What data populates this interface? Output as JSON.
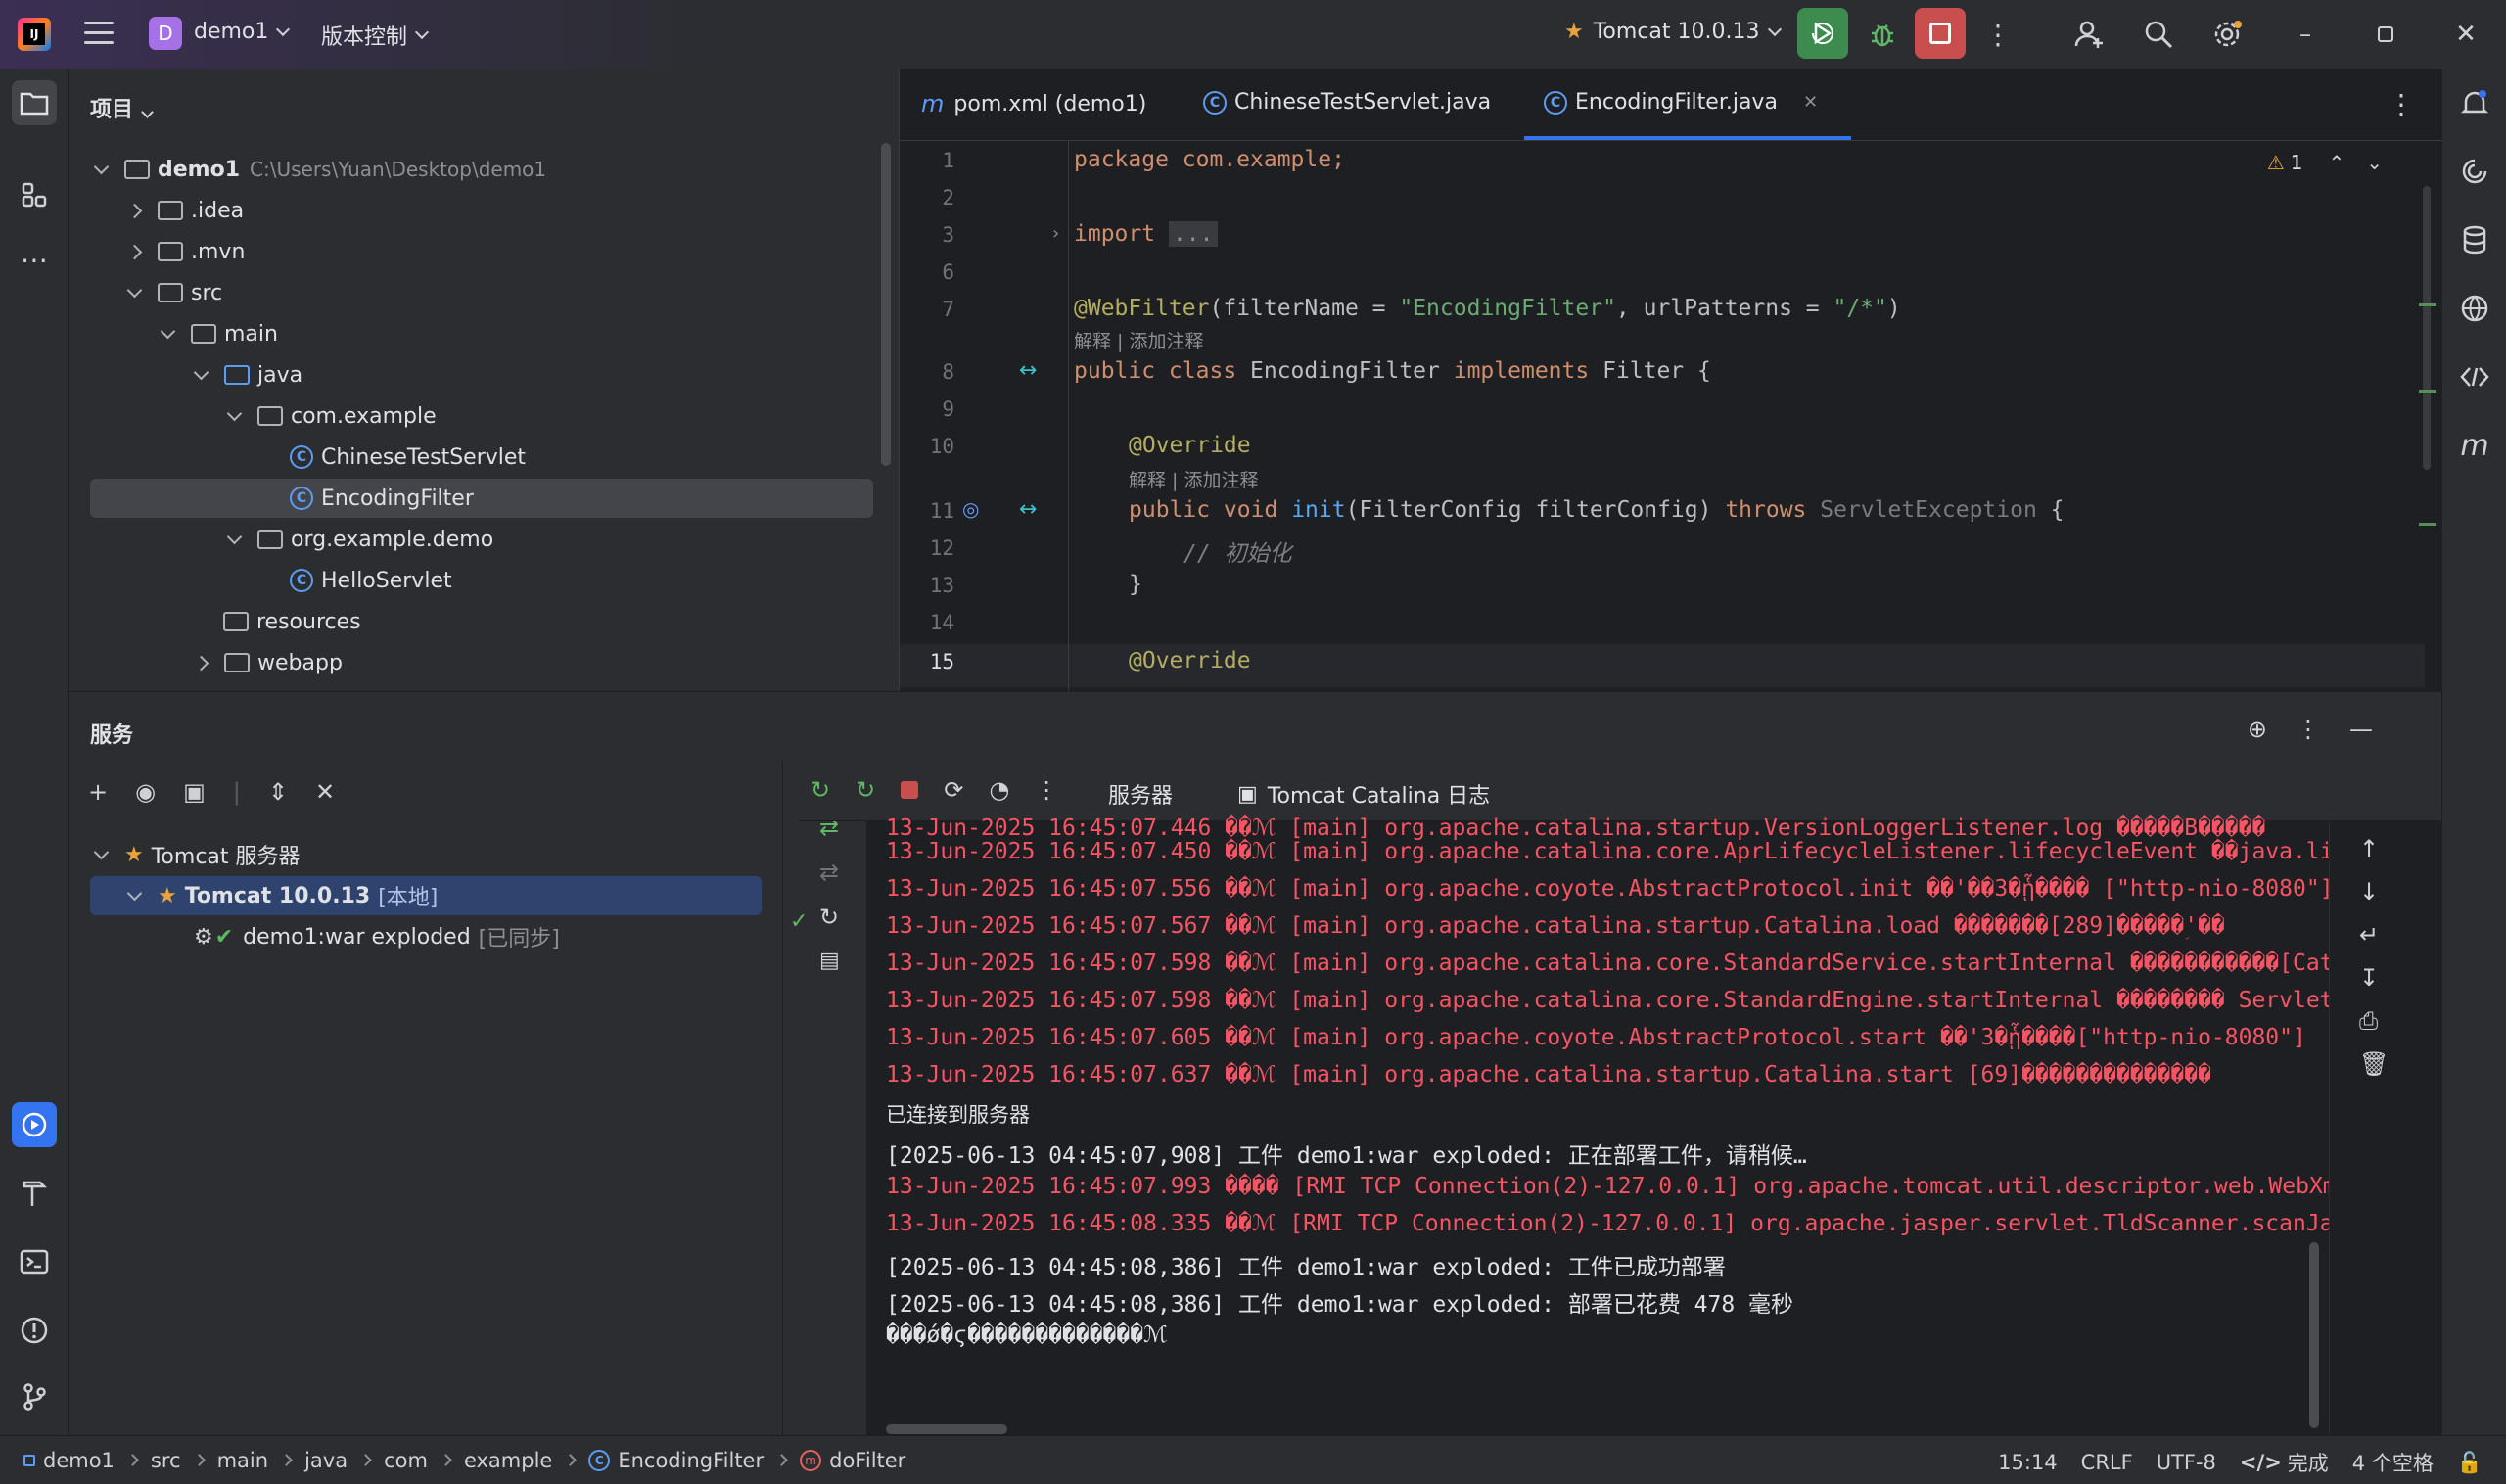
{
  "titlebar": {
    "project_badge": "D",
    "project_name": "demo1",
    "vcs_label": "版本控制",
    "run_config": "Tomcat 10.0.13"
  },
  "project_panel": {
    "title": "项目",
    "tree": [
      {
        "label": "demo1",
        "extra": "C:\\Users\\Yuan\\Desktop\\demo1"
      },
      {
        "label": ".idea"
      },
      {
        "label": ".mvn"
      },
      {
        "label": "src"
      },
      {
        "label": "main"
      },
      {
        "label": "java"
      },
      {
        "label": "com.example"
      },
      {
        "label": "ChineseTestServlet"
      },
      {
        "label": "EncodingFilter"
      },
      {
        "label": "org.example.demo"
      },
      {
        "label": "HelloServlet"
      },
      {
        "label": "resources"
      },
      {
        "label": "webapp"
      }
    ]
  },
  "editor": {
    "tabs": [
      {
        "icon": "m",
        "label": "pom.xml (demo1)"
      },
      {
        "icon": "C",
        "label": "ChineseTestServlet.java"
      },
      {
        "icon": "C",
        "label": "EncodingFilter.java"
      }
    ],
    "warning_count": "1",
    "line_numbers": [
      "1",
      "2",
      "3",
      "6",
      "7",
      "8",
      "9",
      "10",
      "11",
      "12",
      "13",
      "14",
      "15"
    ],
    "code": {
      "l1": "package com.example;",
      "l3_kw": "import",
      "l3_fold": "...",
      "l7_ann": "@WebFilter",
      "l7_a": "(filterName = ",
      "l7_s1": "\"EncodingFilter\"",
      "l7_b": ", urlPatterns = ",
      "l7_s2": "\"/*\"",
      "l7_c": ")",
      "hint": "解释 | 添加注释",
      "l8_kw": "public class",
      "l8_a": " EncodingFilter ",
      "l8_kw2": "implements",
      "l8_b": " Filter {",
      "l10_ann": "@Override",
      "l11_kw": "public void",
      "l11_fn": "init",
      "l11_a": "(FilterConfig filterConfig) ",
      "l11_kw2": "throws",
      "l11_grey": " ServletException",
      "l11_b": " {",
      "l12_cm": "// 初始化",
      "l13": "}",
      "l15_ann": "@Override"
    }
  },
  "services": {
    "title": "服务",
    "tree": [
      {
        "label": "Tomcat 服务器"
      },
      {
        "label": "Tomcat 10.0.13",
        "extra": "[本地]"
      },
      {
        "label": "demo1:war exploded",
        "extra": "[已同步]"
      }
    ],
    "tabs": [
      {
        "label": "服务器"
      },
      {
        "label": "Tomcat Catalina 日志"
      }
    ],
    "log_lines": [
      {
        "text": "13-Jun-2025 16:45:07.446 ��ℳ [main] org.apache.catalina.startup.VersionLoggerListener.log �����B�����     -",
        "red": true
      },
      {
        "text": "13-Jun-2025 16:45:07.450 ��ℳ [main] org.apache.catalina.core.AprLifecycleListener.lifecycleEvent ��java.libra",
        "red": true
      },
      {
        "text": "13-Jun-2025 16:45:07.556 ��ℳ [main] org.apache.coyote.AbstractProtocol.init ��'��3�ᾗ���� [\"http-nio-8080\"]",
        "red": true
      },
      {
        "text": "13-Jun-2025 16:45:07.567 ��ℳ [main] org.apache.catalina.startup.Catalina.load �������[289]�����ؚ'��",
        "red": true
      },
      {
        "text": "13-Jun-2025 16:45:07.598 ��ℳ [main] org.apache.catalina.core.StandardService.startInternal �����������[Catal",
        "red": true
      },
      {
        "text": "13-Jun-2025 16:45:07.598 ��ℳ [main] org.apache.catalina.core.StandardEngine.startInternal �������� Servlet ��",
        "red": true
      },
      {
        "text": "13-Jun-2025 16:45:07.605 ��ℳ [main] org.apache.coyote.AbstractProtocol.start ��'3�ᾗ����[\"http-nio-8080\"]",
        "red": true
      },
      {
        "text": "13-Jun-2025 16:45:07.637 ��ℳ [main] org.apache.catalina.startup.Catalina.start [69]��������������",
        "red": true
      },
      {
        "text": "已连接到服务器",
        "red": false
      },
      {
        "text": "[2025-06-13 04:45:07,908] 工件 demo1:war exploded: 正在部署工件，请稍候…",
        "red": false
      },
      {
        "text": "13-Jun-2025 16:45:07.993 ���� [RMI TCP Connection(2)-127.0.0.1] org.apache.tomcat.util.descriptor.web.WebXml.",
        "red": true
      },
      {
        "text": "13-Jun-2025 16:45:08.335 ��ℳ [RMI TCP Connection(2)-127.0.0.1] org.apache.jasper.servlet.TldScanner.scanJars",
        "red": true
      },
      {
        "text": "[2025-06-13 04:45:08,386] 工件 demo1:war exploded: 工件已成功部署",
        "red": false
      },
      {
        "text": "[2025-06-13 04:45:08,386] 工件 demo1:war exploded: 部署已花费 478 毫秒",
        "red": false
      },
      {
        "text": "���ǿ�ϛ�������������ℳ",
        "red": false
      }
    ]
  },
  "statusbar": {
    "breadcrumbs": [
      "demo1",
      "src",
      "main",
      "java",
      "com",
      "example",
      "EncodingFilter",
      "doFilter"
    ],
    "position": "15:14",
    "line_sep": "CRLF",
    "encoding": "UTF-8",
    "status": "完成",
    "indent": "4 个空格"
  },
  "colors": {
    "accent": "#3574f0",
    "run_green": "#3d8b4f",
    "stop_red": "#c94f4f",
    "log_red": "#f75464"
  }
}
